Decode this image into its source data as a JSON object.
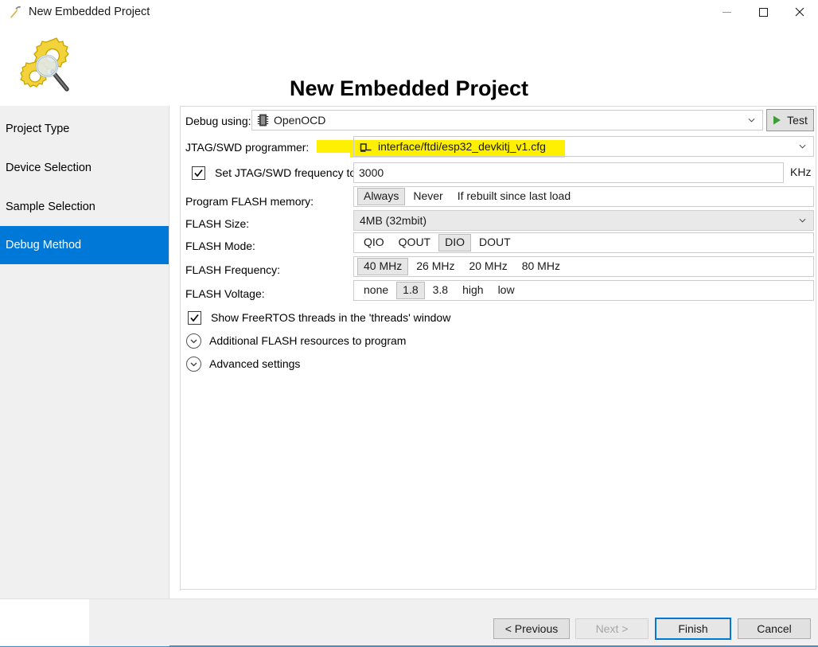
{
  "window": {
    "title": "New Embedded Project",
    "app_icon": "hammer-icon",
    "minimize_label": "Minimize",
    "maximize_label": "Maximize",
    "close_label": "Close"
  },
  "header": {
    "title": "New Embedded Project",
    "icon": "gears-magnifier-icon"
  },
  "sidebar": {
    "items": [
      {
        "label": "Project Type",
        "selected": false
      },
      {
        "label": "Device Selection",
        "selected": false
      },
      {
        "label": "Sample Selection",
        "selected": false
      },
      {
        "label": "Debug Method",
        "selected": true
      }
    ],
    "selected_color": "#0078d7"
  },
  "form": {
    "debug_using": {
      "label": "Debug using:",
      "value": "OpenOCD",
      "icon": "chip-icon"
    },
    "test_button": {
      "label": "Test",
      "icon": "play-icon",
      "icon_color": "#3f9b35"
    },
    "programmer": {
      "label": "JTAG/SWD programmer:",
      "value": "interface/ftdi/esp32_devkitj_v1.cfg",
      "icon": "pulse-signal-icon",
      "highlighted": true,
      "highlight_color": "#fff000"
    },
    "frequency": {
      "checkbox_checked": true,
      "label": "Set JTAG/SWD frequency to:",
      "value": "3000",
      "unit": "KHz"
    },
    "program_flash": {
      "label": "Program FLASH memory:",
      "options": [
        "Always",
        "Never",
        "If rebuilt since last load"
      ],
      "selected": "Always"
    },
    "flash_size": {
      "label": "FLASH Size:",
      "value": "4MB (32mbit)"
    },
    "flash_mode": {
      "label": "FLASH Mode:",
      "options": [
        "QIO",
        "QOUT",
        "DIO",
        "DOUT"
      ],
      "selected": "DIO"
    },
    "flash_frequency": {
      "label": "FLASH Frequency:",
      "options": [
        "40 MHz",
        "26 MHz",
        "20 MHz",
        "80 MHz"
      ],
      "selected": "40 MHz"
    },
    "flash_voltage": {
      "label": "FLASH Voltage:",
      "options": [
        "none",
        "1.8",
        "3.8",
        "high",
        "low"
      ],
      "selected": "1.8"
    },
    "freertos": {
      "label": "Show FreeRTOS threads in the 'threads' window",
      "checked": true
    },
    "expanders": [
      {
        "label": "Additional FLASH resources to program",
        "expanded": false
      },
      {
        "label": "Advanced settings",
        "expanded": false
      }
    ]
  },
  "footer": {
    "buttons": [
      {
        "label": "< Previous",
        "state": "enabled"
      },
      {
        "label": "Next >",
        "state": "disabled"
      },
      {
        "label": "Finish",
        "state": "default"
      },
      {
        "label": "Cancel",
        "state": "enabled"
      }
    ]
  }
}
